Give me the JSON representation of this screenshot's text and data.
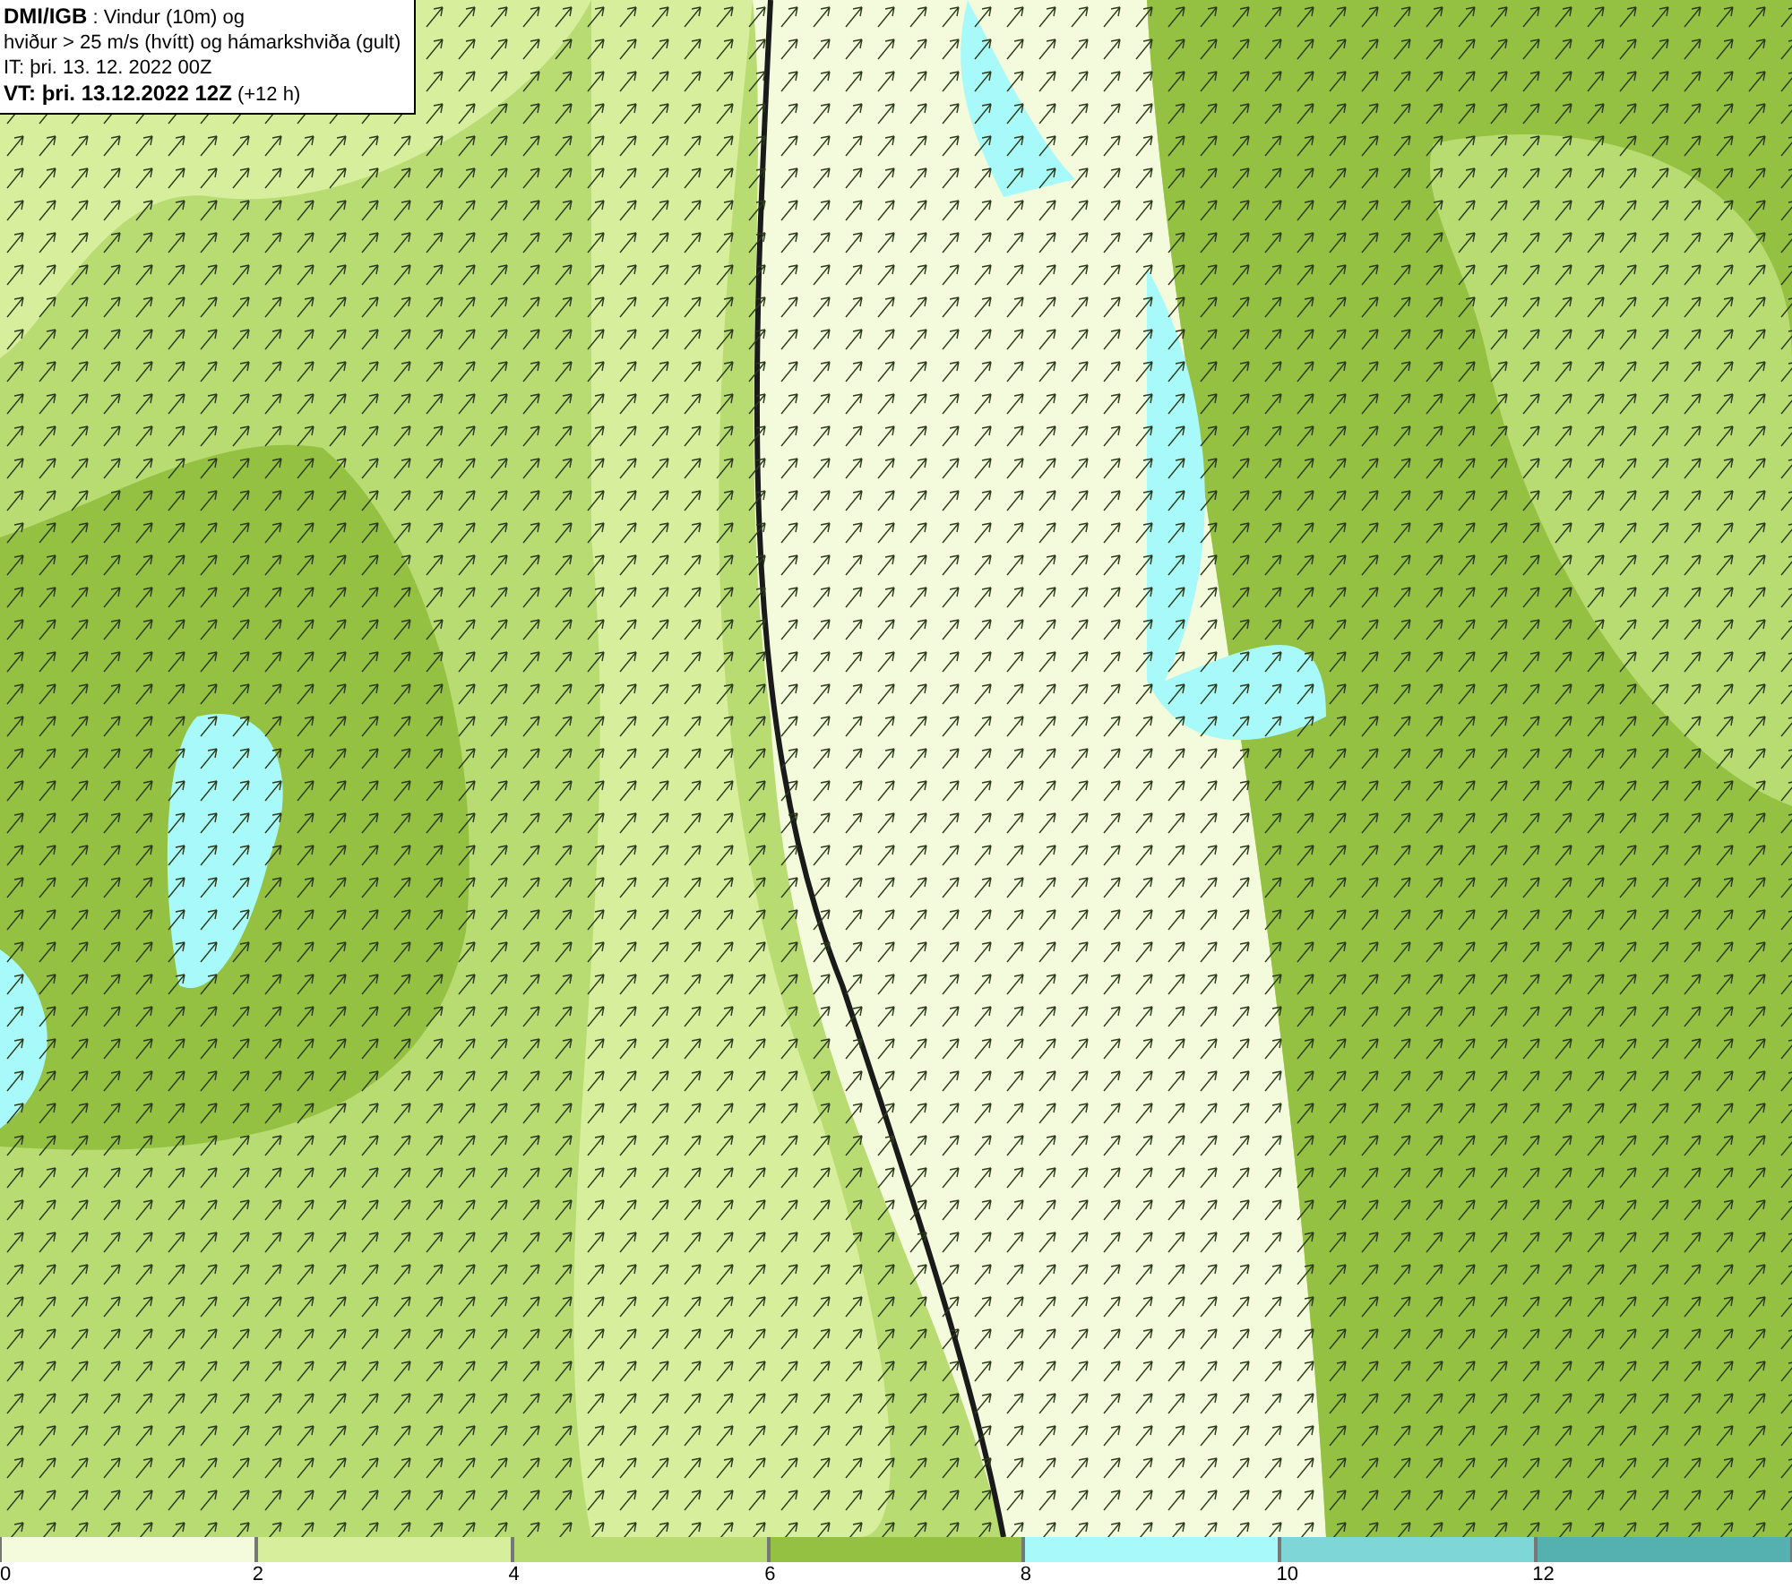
{
  "header": {
    "lines": [
      "**DMI/IGB** : Vindur (10m) og",
      "hviður > 25 m/s (hvítt) og hámarkshviða (gult)",
      "IT: þri. 13. 12. 2022 00Z",
      "**VT: þri. 13.12.2022 12Z** (+12 h)"
    ]
  },
  "legend": {
    "segments": [
      {
        "label": "0",
        "color": "#f4fbdc"
      },
      {
        "label": "2",
        "color": "#d7ef9c"
      },
      {
        "label": "4",
        "color": "#b8db72"
      },
      {
        "label": "6",
        "color": "#94c142"
      },
      {
        "label": "8",
        "color": "#a8fafa"
      },
      {
        "label": "10",
        "color": "#7fd6d6"
      },
      {
        "label": "12",
        "color": "#55b0b0"
      }
    ]
  }
}
